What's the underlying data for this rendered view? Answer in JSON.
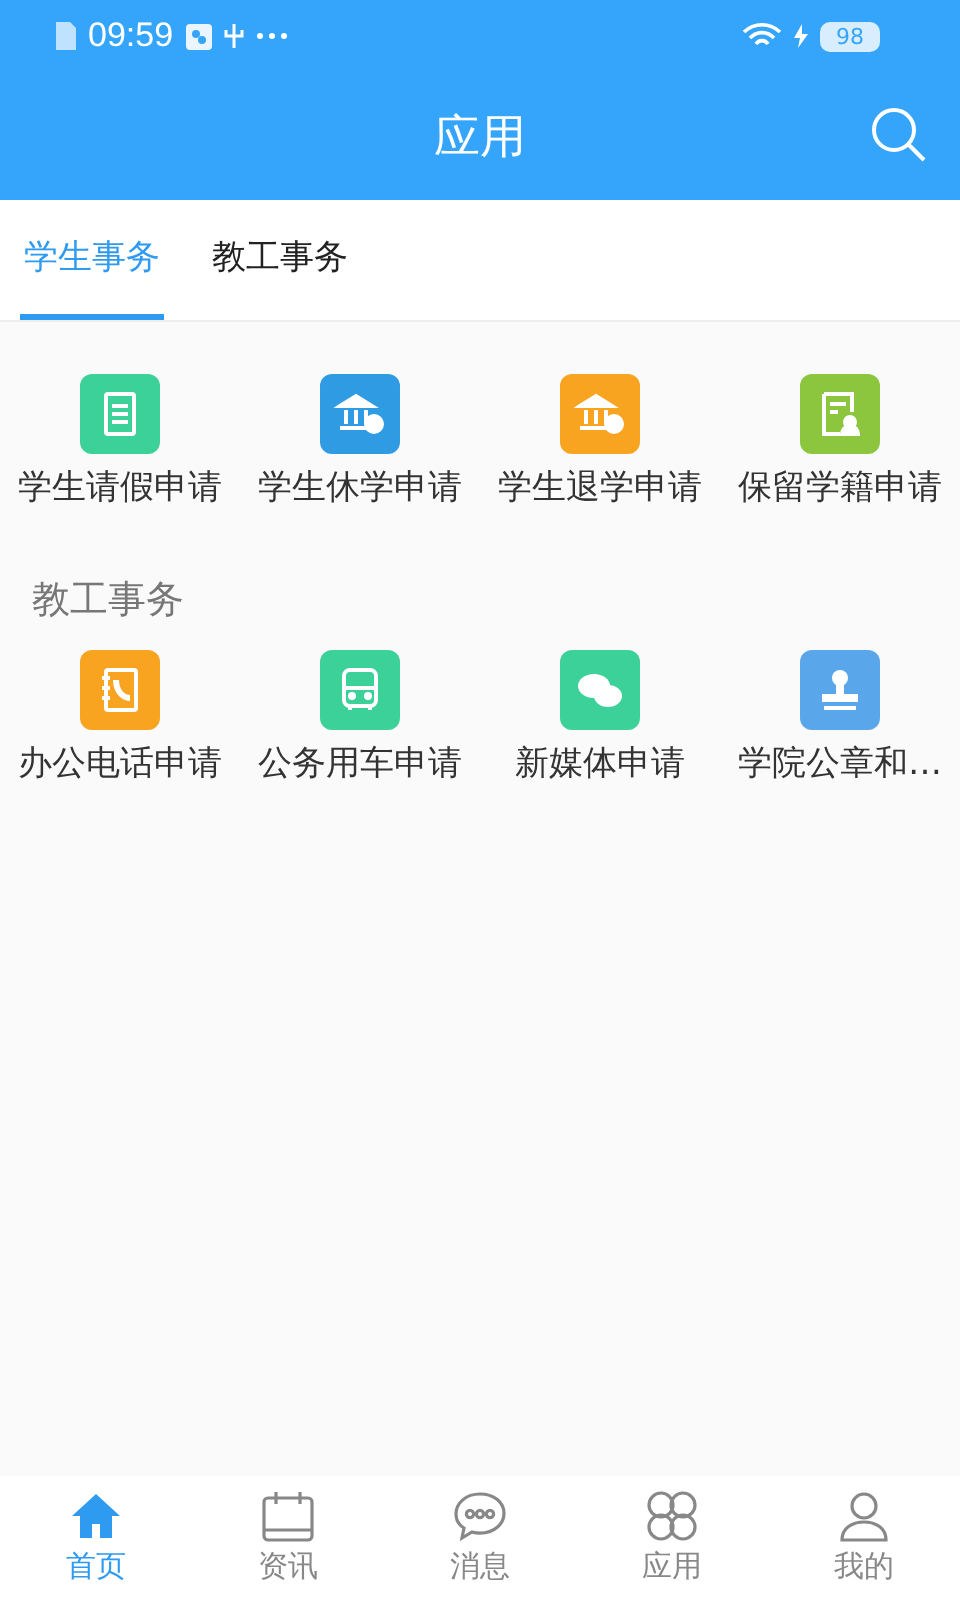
{
  "status_bar": {
    "time": "09:59",
    "battery": "98"
  },
  "header": {
    "title": "应用"
  },
  "tabs": [
    {
      "label": "学生事务",
      "selected": true
    },
    {
      "label": "教工事务",
      "selected": false
    }
  ],
  "sections": [
    {
      "apps": [
        {
          "label": "学生请假申请",
          "kind": "document",
          "color": "#3dd19a"
        },
        {
          "label": "学生休学申请",
          "kind": "bank",
          "color": "#2f9be3"
        },
        {
          "label": "学生退学申请",
          "kind": "bank",
          "color": "#f8a421"
        },
        {
          "label": "保留学籍申请",
          "kind": "form",
          "color": "#8cc63e"
        }
      ]
    },
    {
      "heading": "教工事务",
      "apps": [
        {
          "label": "办公电话申请",
          "kind": "phonebook",
          "color": "#f8a421"
        },
        {
          "label": "公务用车申请",
          "kind": "bus",
          "color": "#3dd19a"
        },
        {
          "label": "新媒体申请",
          "kind": "chat",
          "color": "#3dd19a"
        },
        {
          "label": "学院公章和…",
          "kind": "stamp",
          "color": "#5aa6ea"
        }
      ]
    }
  ],
  "nav": [
    {
      "label": "首页",
      "kind": "home",
      "selected": true
    },
    {
      "label": "资讯",
      "kind": "calendar",
      "selected": false
    },
    {
      "label": "消息",
      "kind": "message",
      "selected": false
    },
    {
      "label": "应用",
      "kind": "apps",
      "selected": false
    },
    {
      "label": "我的",
      "kind": "person",
      "selected": false
    }
  ]
}
